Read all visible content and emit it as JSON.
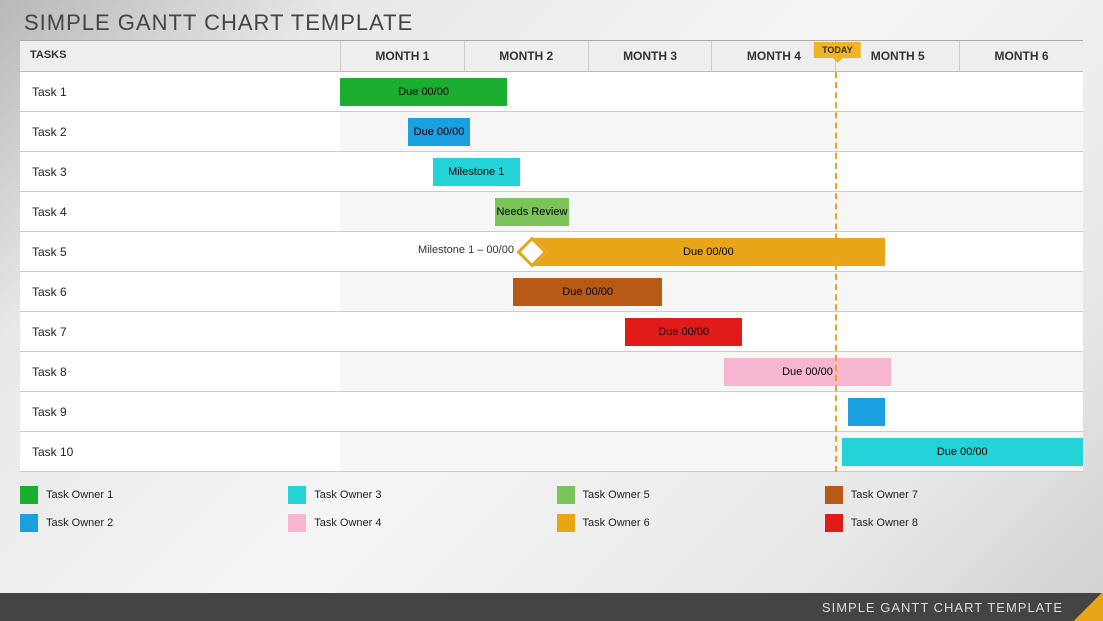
{
  "title": "SIMPLE GANTT CHART TEMPLATE",
  "footer_title": "SIMPLE GANTT CHART TEMPLATE",
  "tasks_header": "TASKS",
  "today_label": "TODAY",
  "months": [
    "MONTH 1",
    "MONTH 2",
    "MONTH 3",
    "MONTH 4",
    "MONTH 5",
    "MONTH 6"
  ],
  "legend": [
    {
      "label": "Task Owner 1",
      "color": "#1aad2f"
    },
    {
      "label": "Task Owner 3",
      "color": "#23d3d8"
    },
    {
      "label": "Task Owner 5",
      "color": "#7cc35a"
    },
    {
      "label": "Task Owner 7",
      "color": "#b75a16"
    },
    {
      "label": "Task Owner 2",
      "color": "#1a9fe0"
    },
    {
      "label": "Task Owner 4",
      "color": "#f7b6cf"
    },
    {
      "label": "Task Owner 6",
      "color": "#e8a517"
    },
    {
      "label": "Task Owner 8",
      "color": "#e11a1a"
    }
  ],
  "chart_data": {
    "type": "gantt",
    "x_unit": "month",
    "x_range": [
      0,
      6
    ],
    "today_at": 4.0,
    "tasks": [
      {
        "name": "Task 1",
        "start": 0.0,
        "end": 1.35,
        "label": "Due 00/00",
        "color": "#1aad2f"
      },
      {
        "name": "Task 2",
        "start": 0.55,
        "end": 1.05,
        "label": "Due 00/00",
        "color": "#1a9fe0"
      },
      {
        "name": "Task 3",
        "start": 0.75,
        "end": 1.45,
        "label": "Milestone 1",
        "color": "#23d3d8"
      },
      {
        "name": "Task 4",
        "start": 1.25,
        "end": 1.85,
        "label": "Needs Review",
        "color": "#7cc35a"
      },
      {
        "name": "Task 5",
        "start": 1.55,
        "end": 4.4,
        "label": "Due 00/00",
        "color": "#e8a517",
        "milestone_at": 1.55,
        "milestone_label": "Milestone 1 – 00/00"
      },
      {
        "name": "Task 6",
        "start": 1.4,
        "end": 2.6,
        "label": "Due 00/00",
        "color": "#b75a16"
      },
      {
        "name": "Task 7",
        "start": 2.3,
        "end": 3.25,
        "label": "Due 00/00",
        "color": "#e11a1a"
      },
      {
        "name": "Task 8",
        "start": 3.1,
        "end": 4.45,
        "label": "Due 00/00",
        "color": "#f7b6cf"
      },
      {
        "name": "Task 9",
        "start": 4.1,
        "end": 4.4,
        "label": "",
        "color": "#1a9fe0"
      },
      {
        "name": "Task 10",
        "start": 4.05,
        "end": 6.0,
        "label": "Due 00/00",
        "color": "#23d3d8"
      }
    ]
  }
}
